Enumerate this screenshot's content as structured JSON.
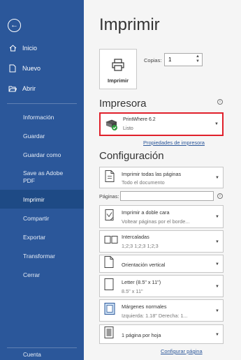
{
  "sidebar": {
    "top_items": [
      {
        "label": "Inicio",
        "icon": "home-icon"
      },
      {
        "label": "Nuevo",
        "icon": "new-document-icon"
      },
      {
        "label": "Abrir",
        "icon": "open-folder-icon"
      }
    ],
    "items": [
      {
        "label": "Información"
      },
      {
        "label": "Guardar"
      },
      {
        "label": "Guardar como"
      },
      {
        "label": "Save as Adobe PDF"
      },
      {
        "label": "Imprimir",
        "active": true
      },
      {
        "label": "Compartir"
      },
      {
        "label": "Exportar"
      },
      {
        "label": "Transformar"
      },
      {
        "label": "Cerrar"
      }
    ],
    "bottom_label": "Cuenta"
  },
  "main": {
    "title": "Imprimir",
    "print_button_label": "Imprimir",
    "copies_label": "Copias:",
    "copies_value": "1"
  },
  "printer": {
    "section_title": "Impresora",
    "name": "PrintWhere 6.2",
    "status": "Listo",
    "properties_link": "Propiedades de impresora"
  },
  "settings": {
    "section_title": "Configuración",
    "print_range": {
      "title": "Imprimir todas las páginas",
      "subtitle": "Todo el documento"
    },
    "pages_label": "Páginas:",
    "duplex": {
      "title": "Imprimir a doble cara",
      "subtitle": "Voltear páginas por el borde..."
    },
    "collate": {
      "title": "Intercaladas",
      "subtitle": "1;2;3   1;2;3   1;2;3"
    },
    "orientation": {
      "title": "Orientación vertical"
    },
    "paper": {
      "title": "Letter (8.5\" x 11\")",
      "subtitle": "8.5\" x 11\""
    },
    "margins": {
      "title": "Márgenes normales",
      "subtitle": "Izquierda: 1.18\"   Derecha: 1..."
    },
    "per_sheet": {
      "title": "1 página por hoja"
    },
    "page_setup_link": "Configurar página"
  },
  "colors": {
    "sidebar": "#2b579a",
    "accent": "#2b579a",
    "highlight_border": "#e0202b"
  }
}
